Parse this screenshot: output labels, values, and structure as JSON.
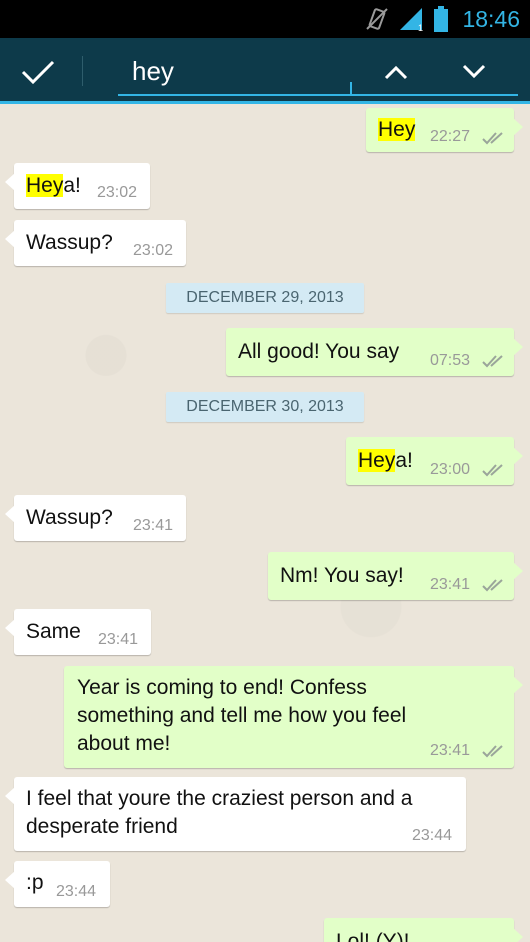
{
  "status_bar": {
    "time": "18:46",
    "colors": {
      "accent": "#33b5e5"
    }
  },
  "action_bar": {
    "search_value": "hey",
    "icons": {
      "confirm": "check-icon",
      "prev": "chevron-up-icon",
      "next": "chevron-down-icon"
    }
  },
  "messages": [
    {
      "dir": "out",
      "highlight": "Hey",
      "rest": "",
      "time": "22:27",
      "status": "read"
    },
    {
      "dir": "in",
      "highlight": "Hey",
      "rest": "a!",
      "time": "23:02"
    },
    {
      "dir": "in",
      "highlight": "",
      "rest": "Wassup?",
      "time": "23:02"
    },
    {
      "dir": "sep",
      "text": "DECEMBER 29, 2013"
    },
    {
      "dir": "out",
      "highlight": "",
      "rest": "All good! You say",
      "time": "07:53",
      "status": "read"
    },
    {
      "dir": "sep",
      "text": "DECEMBER 30, 2013"
    },
    {
      "dir": "out",
      "highlight": "Hey",
      "rest": "a!",
      "time": "23:00",
      "status": "read"
    },
    {
      "dir": "in",
      "highlight": "",
      "rest": "Wassup?",
      "time": "23:41"
    },
    {
      "dir": "out",
      "highlight": "",
      "rest": "Nm! You say!",
      "time": "23:41",
      "status": "read"
    },
    {
      "dir": "in",
      "highlight": "",
      "rest": "Same",
      "time": "23:41"
    },
    {
      "dir": "out",
      "highlight": "",
      "rest": "Year is coming to end! Confess something and tell me how you feel about me!",
      "time": "23:41",
      "status": "read"
    },
    {
      "dir": "in",
      "highlight": "",
      "rest": "I feel that youre the craziest person and a desperate friend",
      "time": "23:44"
    },
    {
      "dir": "in",
      "highlight": "",
      "rest": ":p",
      "time": "23:44"
    },
    {
      "dir": "out",
      "highlight": "",
      "rest": "Lol! (Y)!",
      "time": "",
      "status": ""
    }
  ]
}
